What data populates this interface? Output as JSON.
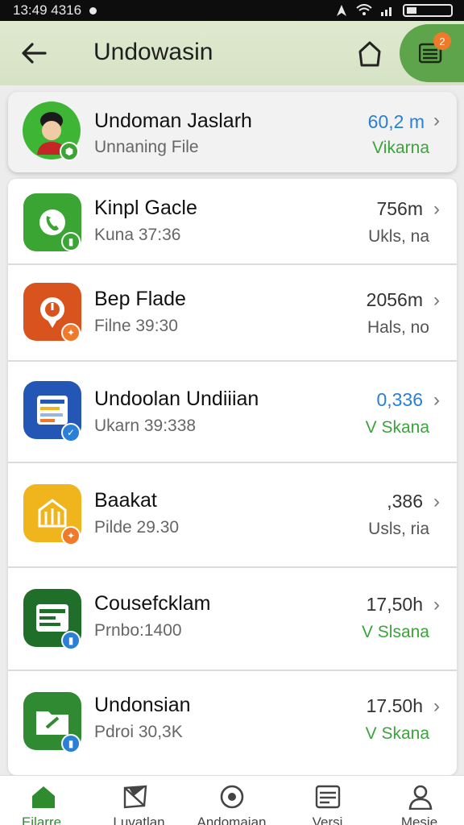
{
  "status_bar": {
    "time": "13:49 4316"
  },
  "app_bar": {
    "title": "Undowasin",
    "menu_badge": "2"
  },
  "colors": {
    "accent": "#5ea44a",
    "value_blue": "#2a7fd6",
    "status_green": "#3ca33c"
  },
  "top_item": {
    "title": "Undoman Jaslarh",
    "subtitle": "Unnaning File",
    "value": "60,2 m",
    "status": "Vikarna",
    "icon": "avatar"
  },
  "items": [
    {
      "title": "Kinpl Gacle",
      "subtitle": "Kuna 37:36",
      "value": "756m",
      "status": "Ukls, na",
      "icon": "phone-icon",
      "color": "#3aa533"
    },
    {
      "title": "Bep Flade",
      "subtitle": "Filne 39:30",
      "value": "2056m",
      "status": "Hals, no",
      "icon": "pin-icon",
      "color": "#d9531e"
    },
    {
      "title": "Undoolan Undiiian",
      "subtitle": "Ukarn 39:338",
      "value": "0,336",
      "status": "V Skana",
      "icon": "document-icon",
      "color": "#2456b5"
    },
    {
      "title": "Baakat",
      "subtitle": "Pilde 29.30",
      "value": ",386",
      "status": "Usls, ria",
      "icon": "building-icon",
      "color": "#f0b41c"
    },
    {
      "title": "Cousefcklam",
      "subtitle": "Prnbo:1400",
      "value": "17,50h",
      "status": "V Slsana",
      "icon": "card-icon",
      "color": "#1f6e2a"
    },
    {
      "title": "Undonsian",
      "subtitle": "Pdroi 30,3K",
      "value": "17.50h",
      "status": "V Skana",
      "icon": "folder-icon",
      "color": "#2f8a32"
    }
  ],
  "nav": [
    {
      "label": "Eilarre",
      "icon": "home-icon"
    },
    {
      "label": "Luvatlan",
      "icon": "map-icon"
    },
    {
      "label": "Andomaian",
      "icon": "target-icon"
    },
    {
      "label": "Versi",
      "icon": "list-icon"
    },
    {
      "label": "Mesie",
      "icon": "profile-icon"
    }
  ]
}
